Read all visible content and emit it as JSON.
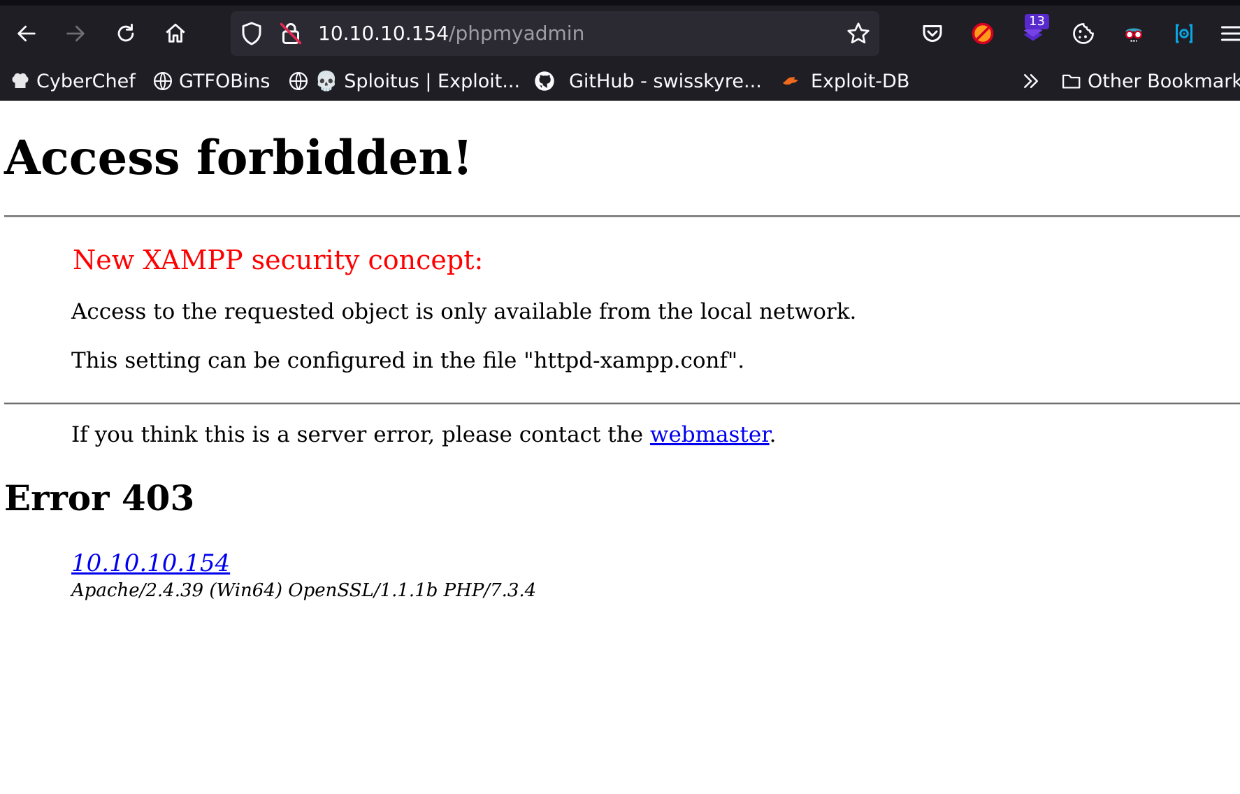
{
  "browser": {
    "url": {
      "host": "10.10.10.154",
      "path": "/phpmyadmin"
    },
    "extension_badge": "13",
    "bookmarks": [
      {
        "label": "CyberChef",
        "icon": "chef-hat-icon"
      },
      {
        "label": "GTFOBins",
        "icon": "globe-icon"
      },
      {
        "label": "💀 Sploitus | Exploit...",
        "icon": "globe-icon"
      },
      {
        "label": "GitHub - swisskyre...",
        "icon": "github-icon"
      },
      {
        "label": "Exploit-DB",
        "icon": "exploit-db-icon"
      }
    ],
    "other_bookmarks_label": "Other Bookmarks",
    "colors": {
      "chrome_bg": "#1f1e25",
      "urlbar_bg": "#2b2a33",
      "badge": "#592acb"
    }
  },
  "page": {
    "title": "Access forbidden!",
    "concept_heading": "New XAMPP security concept:",
    "paragraphs": [
      "Access to the requested object is only available from the local network.",
      "This setting can be configured in the file \"httpd-xampp.conf\"."
    ],
    "contact": {
      "prefix": "If you think this is a server error, please contact the ",
      "link": "webmaster",
      "suffix": "."
    },
    "error_heading": "Error 403",
    "server_link": "10.10.10.154",
    "server_signature": "Apache/2.4.39 (Win64) OpenSSL/1.1.1b PHP/7.3.4",
    "colors": {
      "concept_heading": "#ff0000",
      "link": "#0000ee"
    }
  }
}
